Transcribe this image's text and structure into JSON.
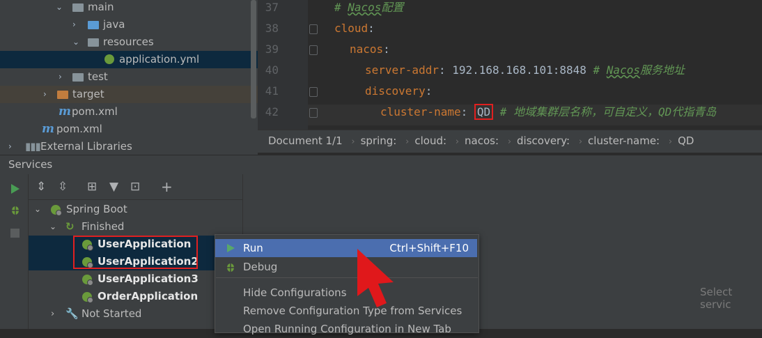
{
  "project_tree": {
    "items": [
      {
        "label": "main"
      },
      {
        "label": "java"
      },
      {
        "label": "resources"
      },
      {
        "label": "application.yml"
      },
      {
        "label": "test"
      },
      {
        "label": "target"
      },
      {
        "label": "pom.xml"
      },
      {
        "label": "pom.xml"
      },
      {
        "label": "External Libraries"
      }
    ],
    "m_glyph": "m"
  },
  "editor": {
    "line_numbers": [
      "37",
      "38",
      "39",
      "40",
      "41",
      "42"
    ],
    "lines": [
      {
        "comment_hash": "# ",
        "comment_word": "Nacos",
        "comment_rest": "配置"
      },
      {
        "key": "cloud",
        "colon": ":"
      },
      {
        "key": "nacos",
        "colon": ":"
      },
      {
        "key": "server-addr",
        "colon": ":",
        "value": " 192.168.168.101:8848 ",
        "comment_hash": "# ",
        "comment_word": "Nacos",
        "comment_rest": "服务地址"
      },
      {
        "key": "discovery",
        "colon": ":"
      },
      {
        "key": "cluster-name",
        "colon": ":",
        "value": "QD",
        "comment": " # 地域集群层名称，可自定义，QD代指青岛"
      }
    ]
  },
  "breadcrumbs": {
    "doc": "Document 1/1",
    "items": [
      "spring:",
      "cloud:",
      "nacos:",
      "discovery:",
      "cluster-name:",
      "QD"
    ],
    "sep": "›"
  },
  "services": {
    "title": "Services",
    "tree": {
      "spring_boot": "Spring Boot",
      "finished": "Finished",
      "apps": [
        "UserApplication",
        "UserApplication2",
        "UserApplication3",
        "OrderApplication"
      ],
      "not_started": "Not Started"
    },
    "placeholder": "Select servic"
  },
  "context_menu": {
    "run": {
      "label": "Run",
      "shortcut": "Ctrl+Shift+F10"
    },
    "debug": {
      "label": "Debug"
    },
    "hide": {
      "label": "Hide Configurations"
    },
    "remove": {
      "label": "Remove Configuration Type from Services"
    },
    "open": {
      "label": "Open Running Configuration in New Tab"
    }
  },
  "colors": {
    "highlight_red": "#e02020",
    "menu_active": "#4b6eaf",
    "selection": "#0d293e"
  }
}
